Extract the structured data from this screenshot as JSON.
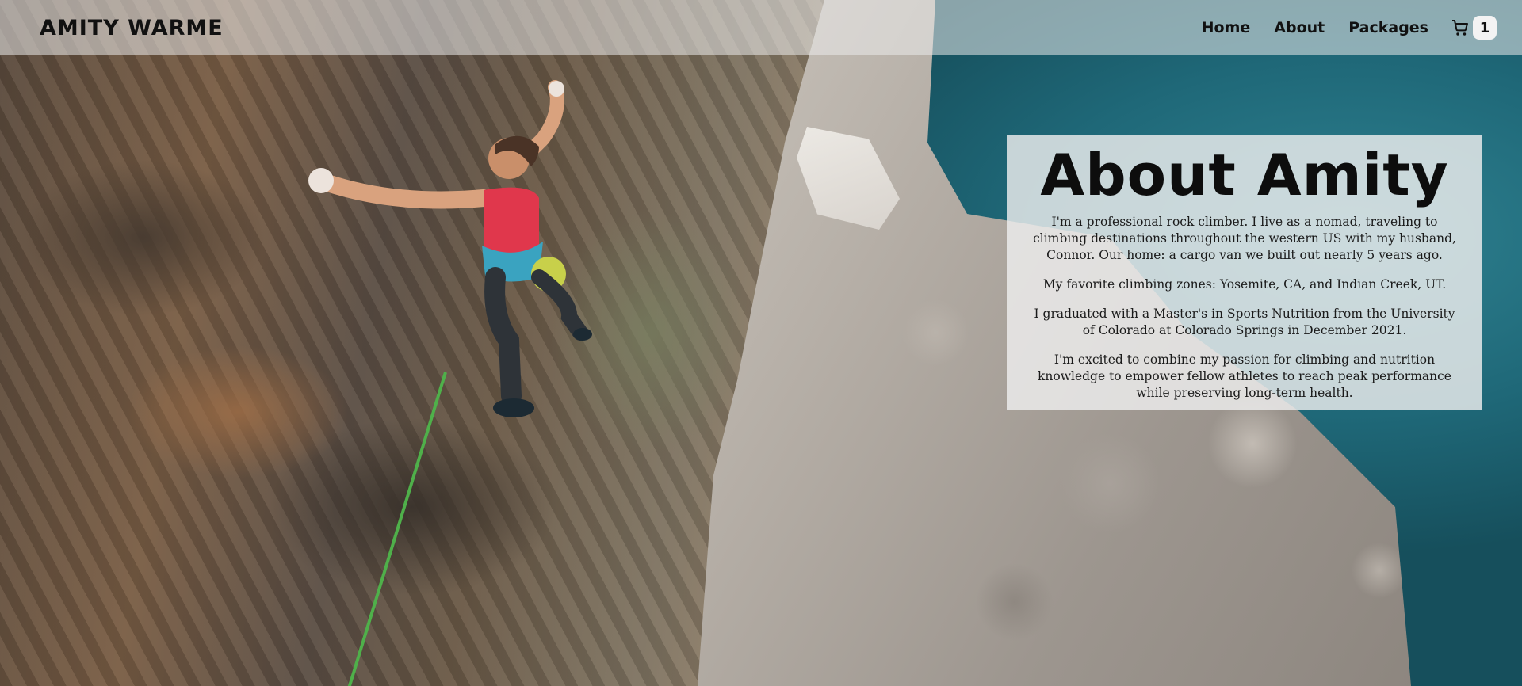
{
  "header": {
    "brand": "AMITY WARME",
    "nav": [
      {
        "label": "Home"
      },
      {
        "label": "About"
      },
      {
        "label": "Packages"
      }
    ],
    "cart": {
      "icon": "cart-icon",
      "count": "1"
    }
  },
  "about": {
    "title": "About Amity",
    "paragraphs": [
      "I'm a professional rock climber. I live as a nomad, traveling to climbing destinations throughout the western US with my husband, Connor. Our home: a cargo van we built out nearly 5 years ago.",
      "My favorite climbing zones: Yosemite, CA, and Indian Creek, UT.",
      "I graduated with a Master's in Sports Nutrition from the University of Colorado at Colorado Springs in December 2021.",
      "I'm excited to combine my passion for climbing and nutrition knowledge to empower fellow athletes to reach peak performance while preserving long-term health."
    ]
  },
  "colors": {
    "header_bg": "#ebebeb",
    "text": "#111111",
    "panel_bg": "#eeeeee",
    "lake": "#1f6878",
    "rope": "#4fb04a"
  }
}
